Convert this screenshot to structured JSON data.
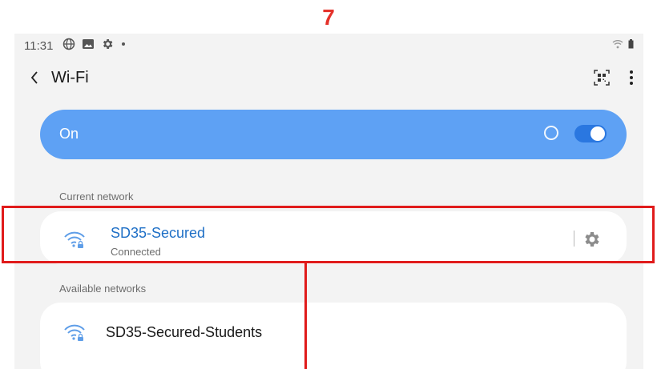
{
  "step": {
    "number": "7"
  },
  "status_bar": {
    "time": "11:31",
    "left_icons": [
      "globe-icon",
      "image-icon",
      "gear-icon",
      "dot-icon"
    ],
    "right_icons": [
      "wifi-signal-icon",
      "battery-icon"
    ]
  },
  "header": {
    "title": "Wi-Fi",
    "back_icon": "chevron-left-icon",
    "actions": [
      "qr-code-icon",
      "more-vertical-icon"
    ]
  },
  "wifi_toggle": {
    "label": "On",
    "state": true
  },
  "current_network": {
    "section_label": "Current network",
    "name": "SD35-Secured",
    "status": "Connected",
    "icon": "wifi-lock-icon",
    "settings_icon": "gear-icon"
  },
  "available_networks": {
    "section_label": "Available networks",
    "items": [
      {
        "name": "SD35-Secured-Students",
        "icon": "wifi-lock-icon"
      }
    ]
  },
  "colors": {
    "accent": "#5ea1f4",
    "switch_on": "#2a77e0",
    "network_link": "#1e6fc6",
    "annotation_red": "#e01b1b",
    "step_number": "#e4322b"
  }
}
